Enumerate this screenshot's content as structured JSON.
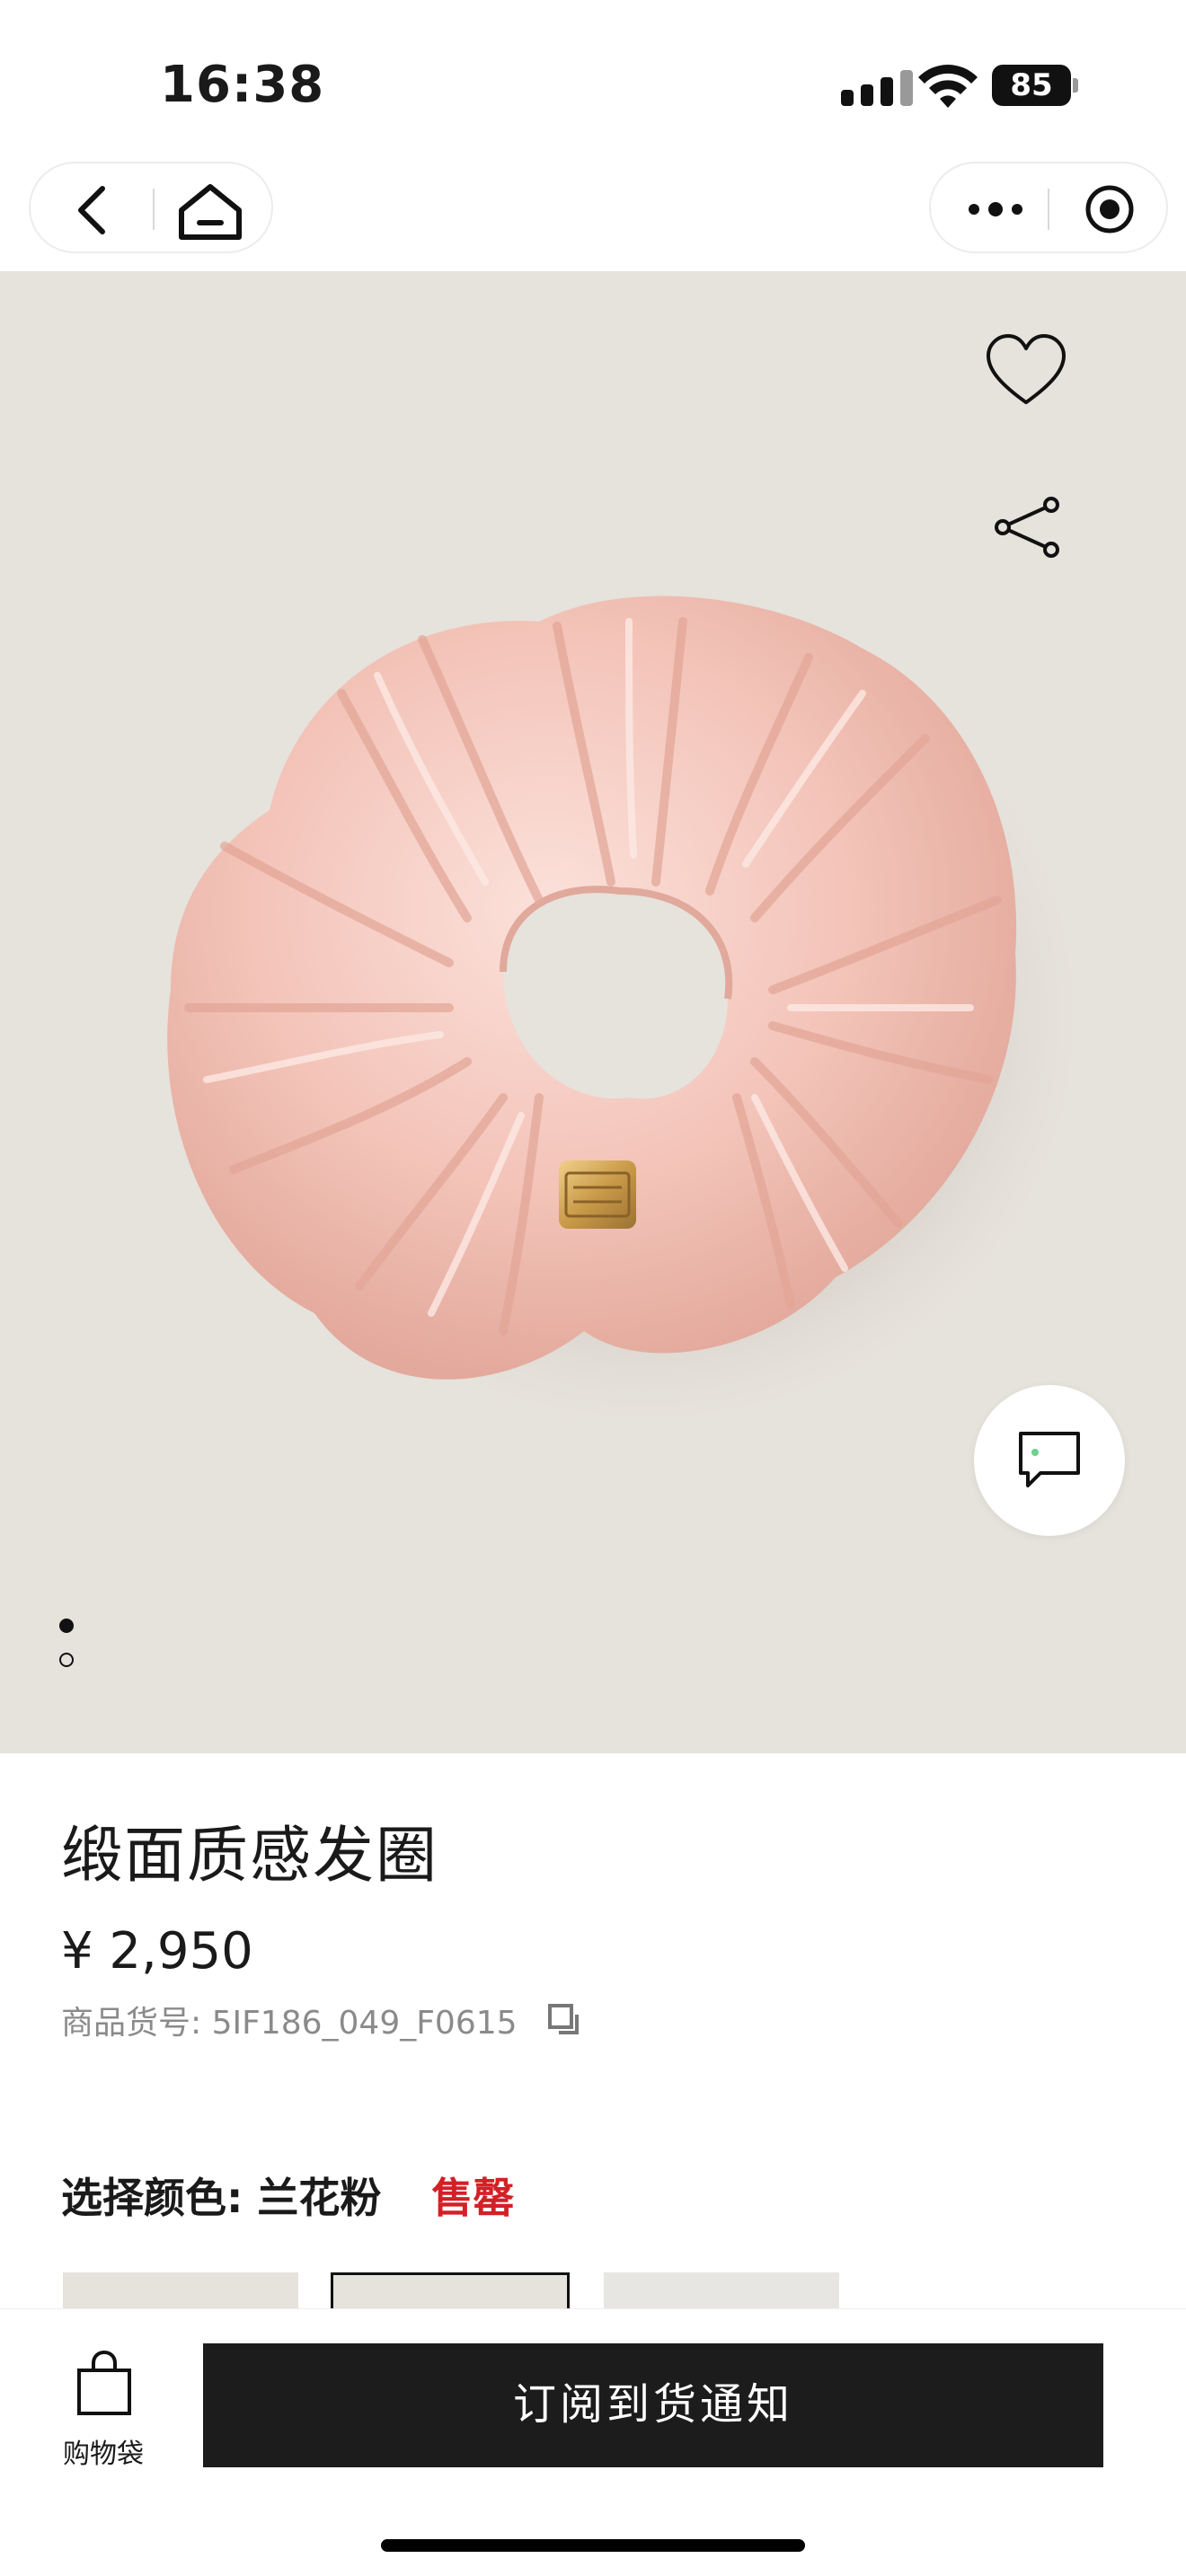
{
  "status_bar": {
    "time": "16:38",
    "battery": "85"
  },
  "nav": {
    "back_icon": "chevron-left-icon",
    "home_icon": "home-icon",
    "more_icon": "more-dots-icon",
    "close_icon": "target-icon"
  },
  "gallery": {
    "image": "pink satin scrunchie with gold logo plaque",
    "favorite_icon": "heart-icon",
    "share_icon": "share-icon",
    "chat_icon": "chat-bubble-icon",
    "page_count": 2,
    "active_page": 1
  },
  "product": {
    "title": "缎面质感发圈",
    "price": "¥ 2,950",
    "sku": "商品货号: 5IF186_049_F0615",
    "color_label": "选择颜色: 兰花粉",
    "stock_status": "售罄"
  },
  "bottom_bar": {
    "cart_label": "购物袋",
    "notify_button": "订阅到货通知"
  },
  "colors": {
    "background": "#e6e2dc",
    "sold_out": "#d32027",
    "button": "#1c1c1c",
    "product_pink": "#f2c1b7"
  }
}
